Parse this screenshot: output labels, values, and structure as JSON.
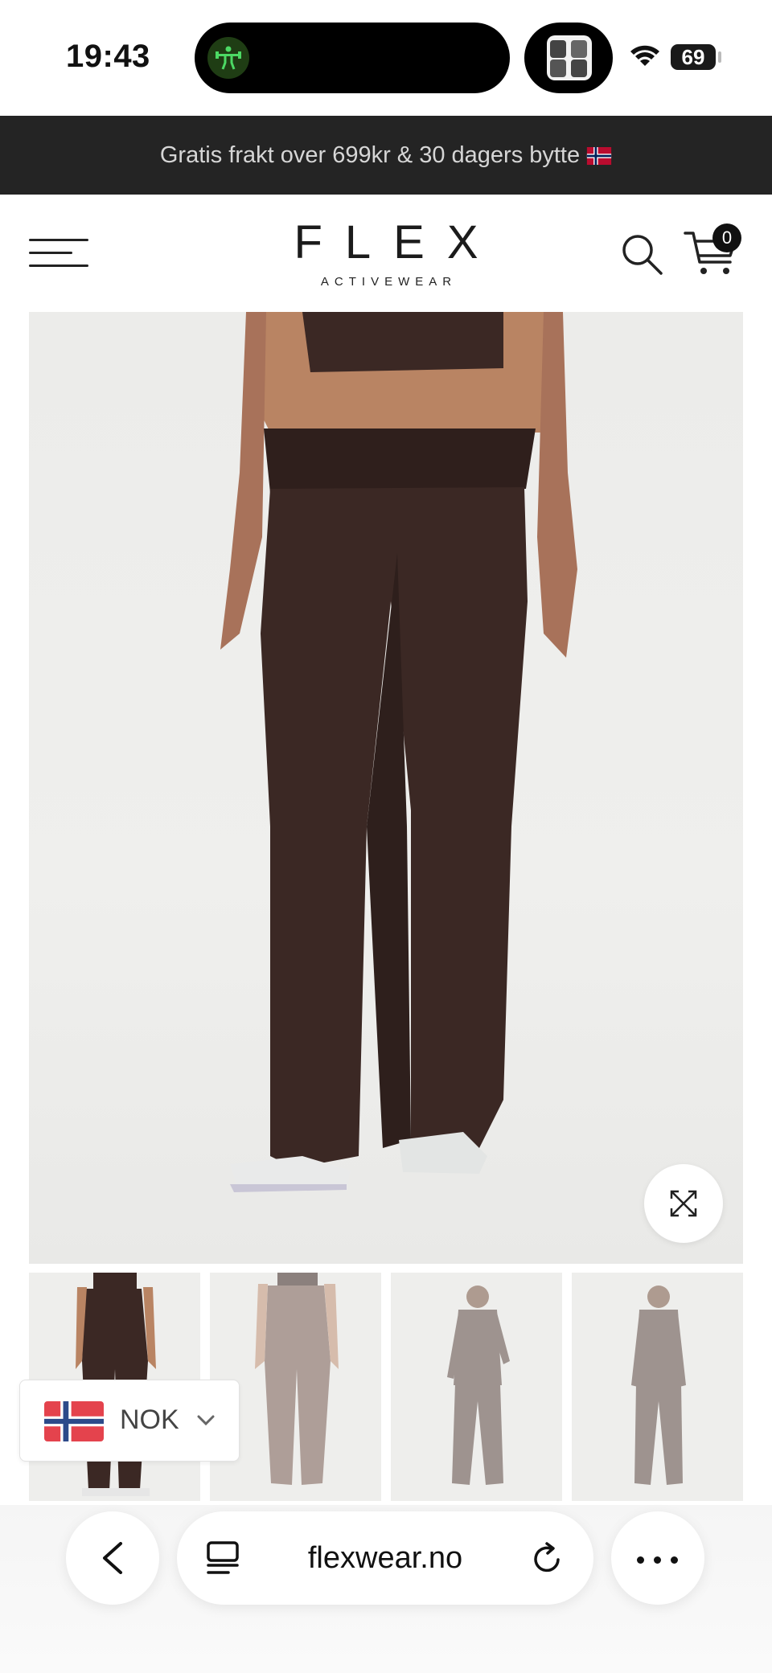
{
  "status_bar": {
    "time": "19:43",
    "battery": "69",
    "icons": [
      "fitness-activity-icon",
      "now-playing-album-icon",
      "wifi-icon",
      "battery-icon"
    ]
  },
  "promo": {
    "text": "Gratis frakt over 699kr & 30 dagers bytte",
    "icon": "norway-flag-icon"
  },
  "header": {
    "logo_main": "FLEX",
    "logo_sub": "ACTIVEWEAR",
    "cart_count": "0",
    "icons": [
      "hamburger-menu-icon",
      "search-icon",
      "shopping-cart-icon"
    ]
  },
  "product": {
    "main_image": "flared-leggings-brown-front",
    "thumbnails": [
      "flared-leggings-front",
      "flared-leggings-back",
      "full-outfit-front",
      "full-outfit-front-alt"
    ],
    "active_thumbnail": 0,
    "zoom_icon": "expand-icon"
  },
  "currency": {
    "code": "NOK",
    "icon": "norway-flag-icon"
  },
  "browser": {
    "url": "flexwear.no",
    "icons": [
      "back-chevron-icon",
      "tabs-icon",
      "reload-icon",
      "more-icon"
    ]
  },
  "colors": {
    "promo_bg": "#242424",
    "pants": "#3b2824",
    "page_bg": "#ffffff"
  }
}
